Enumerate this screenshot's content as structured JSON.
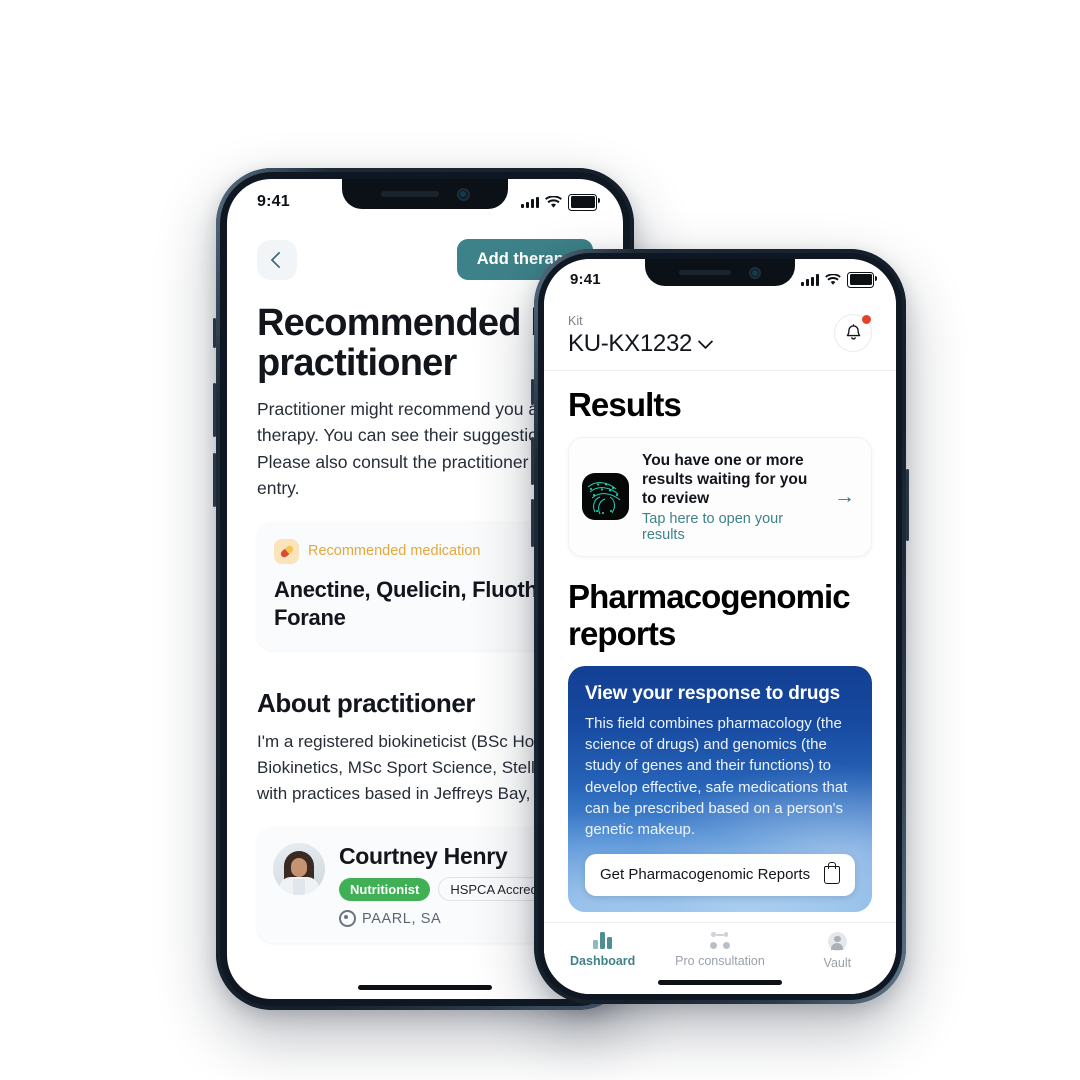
{
  "left_phone": {
    "status_bar": {
      "time": "9:41"
    },
    "nav": {
      "back_label": "Back",
      "add_therapy_label": "Add therapy"
    },
    "title": "Recommended by a practitioner",
    "description": "Practitioner might recommend you a different therapy. You can see their suggestions here. Please also consult the practitioner Journal entry.",
    "description_lines": [
      "Practitioner might recommend you a d",
      "therapy. You can see their suggestions",
      "Please also consult the practitioner Jo",
      "entry."
    ],
    "medication_card": {
      "badge_label": "Recommended medication",
      "names": "Anectine, Quelicin, Fluothane, Forane",
      "names_lines": [
        "Anectine, Quelicin, Fluotha",
        "Forane"
      ]
    },
    "about": {
      "heading": "About practitioner",
      "bio_lines": [
        "I'm a registered biokineticist (BSc Hons",
        "Biokinetics, MSc Sport Science, Stellen",
        "with practices based in Jeffreys Bay, S"
      ]
    },
    "practitioner": {
      "name": "Courtney Henry",
      "tag_role": "Nutritionist",
      "tag_accreditation": "HSPCA Accredited",
      "location": "PAARL, SA"
    }
  },
  "right_phone": {
    "status_bar": {
      "time": "9:41"
    },
    "header": {
      "kit_label": "Kit",
      "kit_value": "KU-KX1232",
      "notification_badge": true
    },
    "results": {
      "heading": "Results",
      "card_title": "You have one or more results waiting for you to review",
      "card_link": "Tap here to open your results"
    },
    "pharmacogenomic": {
      "heading": "Pharmacogenomic reports",
      "card_title": "View your response to drugs",
      "card_body": "This field combines pharmacology (the science of drugs) and genomics (the study of genes and their functions) to develop effective, safe medications that can be prescribed based on a person's genetic makeup.",
      "cta_label": "Get Pharmacogenomic Reports"
    },
    "tabs": [
      {
        "label": "Dashboard",
        "active": true
      },
      {
        "label": "Pro consultation",
        "active": false
      },
      {
        "label": "Vault",
        "active": false
      }
    ]
  },
  "colors": {
    "teal": "#3e8289",
    "blue_card_top": "#123f93",
    "blue_card_bottom": "#7db2e6",
    "green_tag": "#3fb054",
    "amber": "#e2a83c",
    "red_dot": "#e8402e",
    "frame": "#16202b"
  }
}
